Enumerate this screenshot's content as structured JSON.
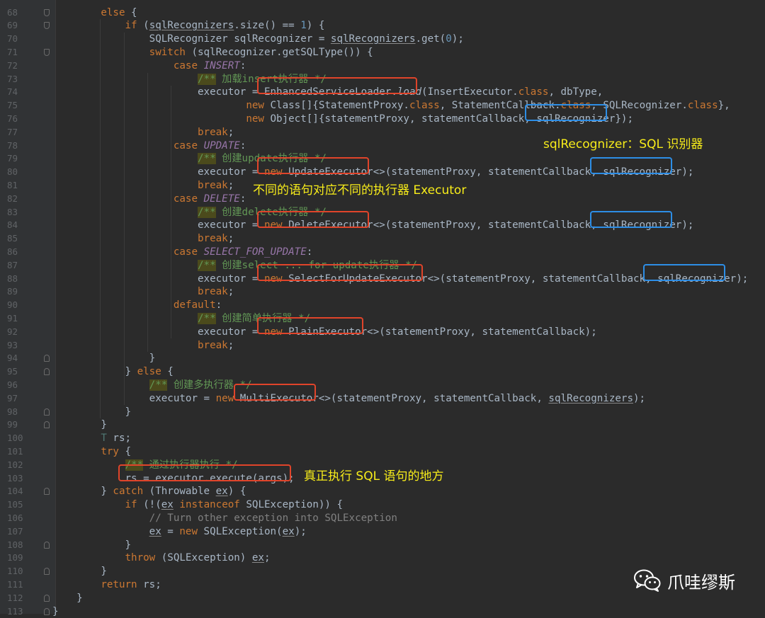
{
  "editor": {
    "line_numbers": [
      "68",
      "69",
      "70",
      "71",
      "72",
      "73",
      "74",
      "75",
      "76",
      "77",
      "78",
      "79",
      "80",
      "81",
      "82",
      "83",
      "84",
      "85",
      "86",
      "87",
      "88",
      "89",
      "90",
      "91",
      "92",
      "93",
      "94",
      "95",
      "96",
      "97",
      "98",
      "99",
      "100",
      "101",
      "102",
      "103",
      "104",
      "105",
      "106",
      "107",
      "108",
      "109",
      "110",
      "111",
      "112",
      "113"
    ],
    "colors": {
      "background": "#2b2b2b",
      "keyword": "#cc7832",
      "constant": "#9876aa",
      "doc_comment": "#629755",
      "comment": "#808080",
      "method": "#ffc66d",
      "highlight_red": "#e0442a",
      "highlight_blue": "#2d8ee6",
      "annotation": "#f7ec1a"
    }
  },
  "annotations": {
    "sql_recognizer": "sqlRecognizer：SQL 识别器",
    "executor_note": "不同的语句对应不同的执行器 Executor",
    "execute_note": "真正执行 SQL 语句的地方"
  },
  "watermark": {
    "icon": "wechat-icon",
    "text": "爪哇缪斯"
  }
}
